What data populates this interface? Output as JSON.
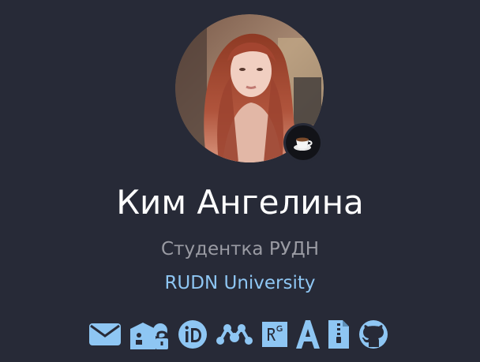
{
  "profile": {
    "name": "Ким Ангелина",
    "title": "Студентка РУДН",
    "affiliation": "RUDN University"
  },
  "status": {
    "icon": "coffee-icon"
  },
  "links": [
    {
      "icon": "email-icon"
    },
    {
      "icon": "google-scholar-icon"
    },
    {
      "icon": "orcid-icon"
    },
    {
      "icon": "mendeley-icon"
    },
    {
      "icon": "researchgate-icon"
    },
    {
      "icon": "academia-icon"
    },
    {
      "icon": "cv-icon"
    },
    {
      "icon": "github-icon"
    }
  ],
  "colors": {
    "background": "#272a37",
    "name": "#ffffff",
    "subtitle": "#9a9ba3",
    "accent": "#8ec6f3"
  }
}
